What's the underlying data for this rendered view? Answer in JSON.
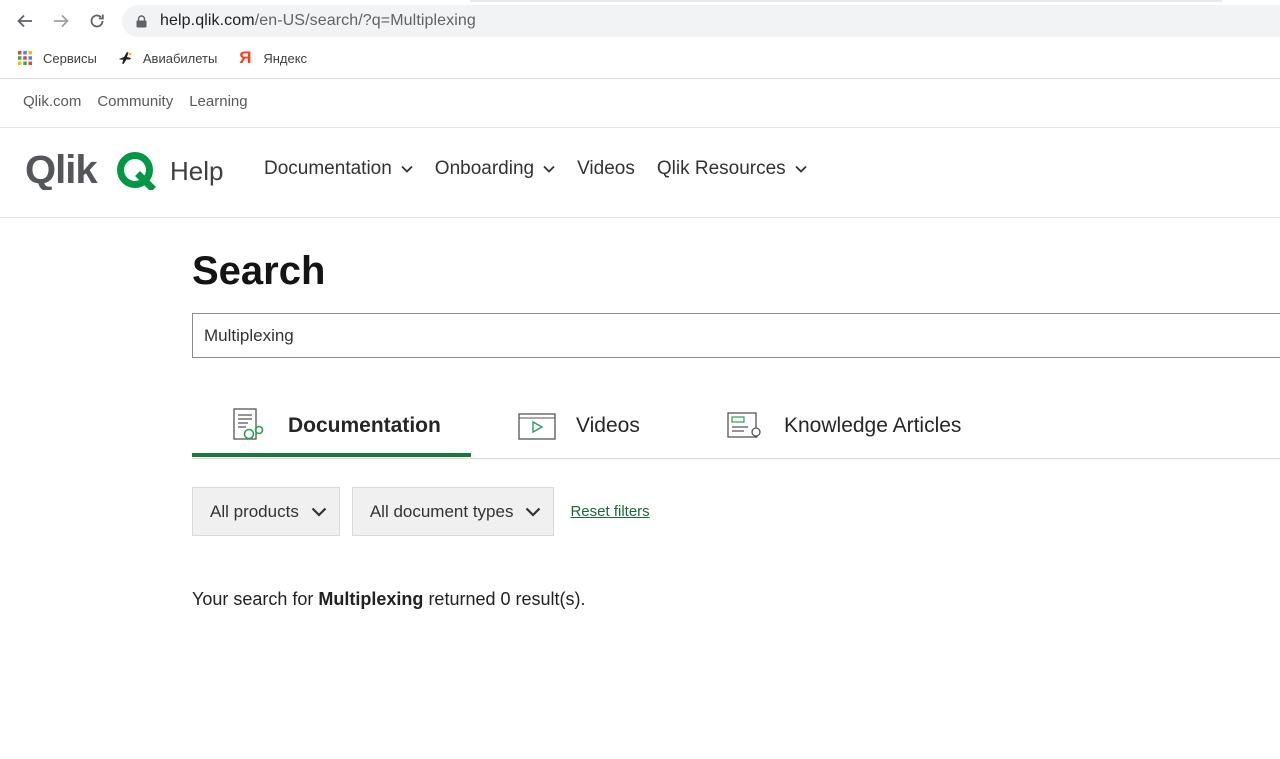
{
  "browser": {
    "url_host": "help.qlik.com",
    "url_path": "/en-US/search/?q=Multiplexing",
    "bookmarks": [
      {
        "label": "Сервисы",
        "icon": "apps-grid-icon"
      },
      {
        "label": "Авиабилеты",
        "icon": "plane-icon"
      },
      {
        "label": "Яндекс",
        "icon": "yandex-icon"
      }
    ]
  },
  "utility_nav": [
    "Qlik.com",
    "Community",
    "Learning"
  ],
  "header": {
    "logo_text": "Qlik",
    "help_label": "Help",
    "nav": [
      {
        "label": "Documentation",
        "has_dropdown": true
      },
      {
        "label": "Onboarding",
        "has_dropdown": true
      },
      {
        "label": "Videos",
        "has_dropdown": false
      },
      {
        "label": "Qlik Resources",
        "has_dropdown": true
      }
    ]
  },
  "main": {
    "title": "Search",
    "search_value": "Multiplexing",
    "tabs": [
      {
        "label": "Documentation",
        "icon": "documentation-icon",
        "active": true
      },
      {
        "label": "Videos",
        "icon": "video-icon",
        "active": false
      },
      {
        "label": "Knowledge Articles",
        "icon": "knowledge-articles-icon",
        "active": false
      }
    ],
    "filters": {
      "products": "All products",
      "doc_types": "All document types",
      "reset": "Reset filters"
    },
    "result": {
      "prefix": "Your search for",
      "query": "Multiplexing",
      "suffix": "returned 0 result(s)."
    }
  },
  "colors": {
    "accent_green": "#1a7a3e",
    "link_green": "#1a6b3a",
    "logo_green": "#009845"
  }
}
